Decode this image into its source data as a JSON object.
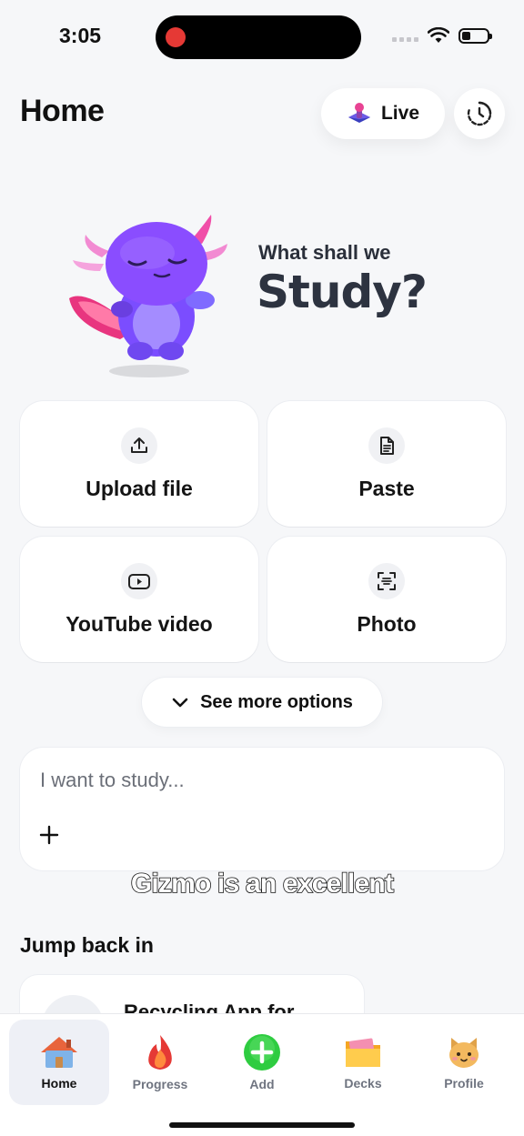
{
  "status_bar": {
    "time": "3:05"
  },
  "header": {
    "title": "Home",
    "live_label": "Live"
  },
  "hero": {
    "line1": "What shall we",
    "line2": "Study?"
  },
  "options": [
    {
      "label": "Upload file",
      "icon": "upload-icon"
    },
    {
      "label": "Paste",
      "icon": "document-icon"
    },
    {
      "label": "YouTube video",
      "icon": "play-icon"
    },
    {
      "label": "Photo",
      "icon": "scan-icon"
    }
  ],
  "more_options_label": "See more options",
  "study_input": {
    "placeholder": "I want to study..."
  },
  "caption": "Gizmo is an excellent",
  "jump_back": {
    "title": "Jump back in",
    "items": [
      {
        "title": "Recycling App for"
      }
    ]
  },
  "tabs": [
    {
      "label": "Home",
      "icon": "house-icon",
      "active": true
    },
    {
      "label": "Progress",
      "icon": "fire-icon",
      "active": false
    },
    {
      "label": "Add",
      "icon": "plus-circle-icon",
      "active": false
    },
    {
      "label": "Decks",
      "icon": "folder-icon",
      "active": false
    },
    {
      "label": "Profile",
      "icon": "cat-icon",
      "active": false
    }
  ],
  "colors": {
    "background": "#f6f7f9",
    "live_icon": "#6c5ce7",
    "add_green": "#2ecc40",
    "fire_red": "#e53935"
  }
}
